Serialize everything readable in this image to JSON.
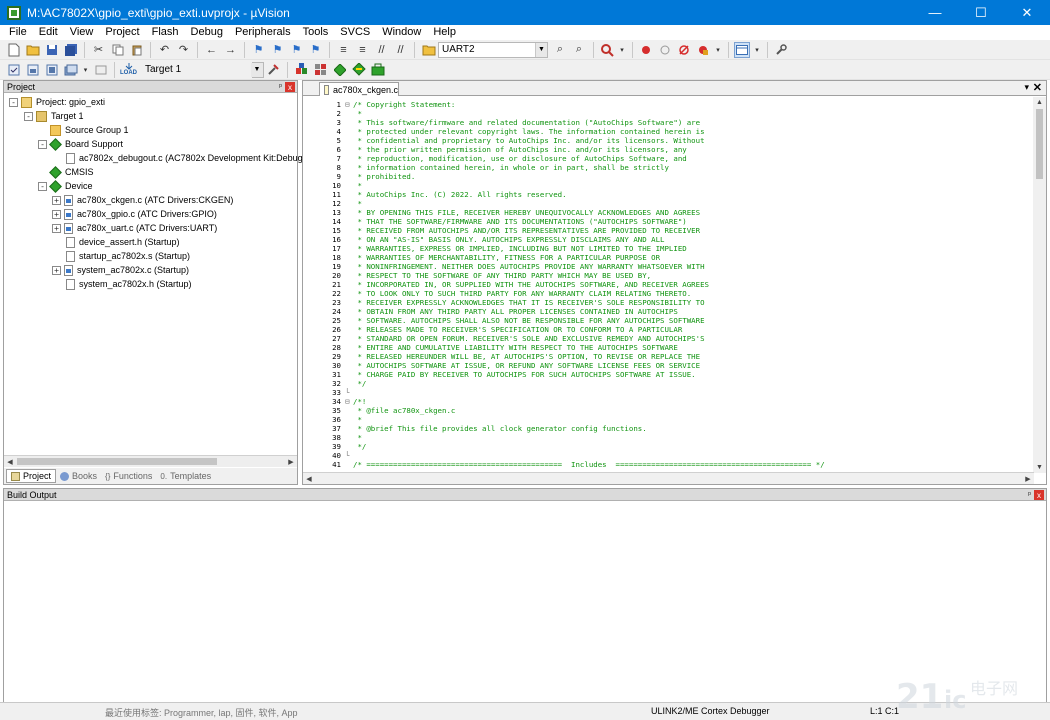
{
  "window": {
    "title": "M:\\AC7802X\\gpio_exti\\gpio_exti.uvprojx - µVision",
    "minimize_glyph": "—",
    "maximize_glyph": "☐",
    "close_glyph": "✕"
  },
  "menu": [
    "File",
    "Edit",
    "View",
    "Project",
    "Flash",
    "Debug",
    "Peripherals",
    "Tools",
    "SVCS",
    "Window",
    "Help"
  ],
  "toolbar": {
    "find_combo_value": "UART2",
    "target_combo_value": "Target 1",
    "load_label": "LOAD"
  },
  "project_panel": {
    "title": "Project",
    "pin_glyph": "ᵖ",
    "close_glyph": "x",
    "tree": [
      {
        "label": "Project: gpio_exti",
        "expander": "-",
        "icon": "project-icon"
      },
      {
        "label": "Target 1",
        "expander": "-",
        "icon": "target-icon"
      },
      {
        "label": "Source Group 1",
        "expander": "",
        "icon": "folder-icon"
      },
      {
        "label": "Board Support",
        "expander": "-",
        "icon": "green-diamond-icon"
      },
      {
        "label": "ac7802x_debugout.c (AC7802x Development Kit:Debug)",
        "expander": "",
        "icon": "file-icon"
      },
      {
        "label": "CMSIS",
        "expander": "",
        "icon": "green-diamond-icon"
      },
      {
        "label": "Device",
        "expander": "-",
        "icon": "green-diamond-icon"
      },
      {
        "label": "ac780x_ckgen.c (ATC Drivers:CKGEN)",
        "expander": "+",
        "icon": "c-file-icon"
      },
      {
        "label": "ac780x_gpio.c (ATC Drivers:GPIO)",
        "expander": "+",
        "icon": "c-file-icon"
      },
      {
        "label": "ac780x_uart.c (ATC Drivers:UART)",
        "expander": "+",
        "icon": "c-file-icon"
      },
      {
        "label": "device_assert.h (Startup)",
        "expander": "",
        "icon": "file-icon"
      },
      {
        "label": "startup_ac7802x.s (Startup)",
        "expander": "",
        "icon": "file-icon"
      },
      {
        "label": "system_ac7802x.c (Startup)",
        "expander": "+",
        "icon": "c-file-icon"
      },
      {
        "label": "system_ac7802x.h (Startup)",
        "expander": "",
        "icon": "file-icon"
      }
    ],
    "tabs": [
      "Project",
      "Books",
      "Functions",
      "Templates"
    ]
  },
  "editor": {
    "tab_label": "ac780x_ckgen.c",
    "dropdown_glyph": "▾",
    "close_glyph": "✕",
    "lines": [
      {
        "n": "1",
        "fold": "⊟",
        "text": "/* Copyright Statement:"
      },
      {
        "n": "2",
        "fold": "",
        "text": " *"
      },
      {
        "n": "3",
        "fold": "",
        "text": " * This software/firmware and related documentation (\"AutoChips Software\") are"
      },
      {
        "n": "4",
        "fold": "",
        "text": " * protected under relevant copyright laws. The information contained herein is"
      },
      {
        "n": "5",
        "fold": "",
        "text": " * confidential and proprietary to AutoChips Inc. and/or its licensors. Without"
      },
      {
        "n": "6",
        "fold": "",
        "text": " * the prior written permission of AutoChips inc. and/or its licensors, any"
      },
      {
        "n": "7",
        "fold": "",
        "text": " * reproduction, modification, use or disclosure of AutoChips Software, and"
      },
      {
        "n": "8",
        "fold": "",
        "text": " * information contained herein, in whole or in part, shall be strictly"
      },
      {
        "n": "9",
        "fold": "",
        "text": " * prohibited."
      },
      {
        "n": "10",
        "fold": "",
        "text": " *"
      },
      {
        "n": "11",
        "fold": "",
        "text": " * AutoChips Inc. (C) 2022. All rights reserved."
      },
      {
        "n": "12",
        "fold": "",
        "text": " *"
      },
      {
        "n": "13",
        "fold": "",
        "text": " * BY OPENING THIS FILE, RECEIVER HEREBY UNEQUIVOCALLY ACKNOWLEDGES AND AGREES"
      },
      {
        "n": "14",
        "fold": "",
        "text": " * THAT THE SOFTWARE/FIRMWARE AND ITS DOCUMENTATIONS (\"AUTOCHIPS SOFTWARE\")"
      },
      {
        "n": "15",
        "fold": "",
        "text": " * RECEIVED FROM AUTOCHIPS AND/OR ITS REPRESENTATIVES ARE PROVIDED TO RECEIVER"
      },
      {
        "n": "16",
        "fold": "",
        "text": " * ON AN \"AS-IS\" BASIS ONLY. AUTOCHIPS EXPRESSLY DISCLAIMS ANY AND ALL"
      },
      {
        "n": "17",
        "fold": "",
        "text": " * WARRANTIES, EXPRESS OR IMPLIED, INCLUDING BUT NOT LIMITED TO THE IMPLIED"
      },
      {
        "n": "18",
        "fold": "",
        "text": " * WARRANTIES OF MERCHANTABILITY, FITNESS FOR A PARTICULAR PURPOSE OR"
      },
      {
        "n": "19",
        "fold": "",
        "text": " * NONINFRINGEMENT. NEITHER DOES AUTOCHIPS PROVIDE ANY WARRANTY WHATSOEVER WITH"
      },
      {
        "n": "20",
        "fold": "",
        "text": " * RESPECT TO THE SOFTWARE OF ANY THIRD PARTY WHICH MAY BE USED BY,"
      },
      {
        "n": "21",
        "fold": "",
        "text": " * INCORPORATED IN, OR SUPPLIED WITH THE AUTOCHIPS SOFTWARE, AND RECEIVER AGREES"
      },
      {
        "n": "22",
        "fold": "",
        "text": " * TO LOOK ONLY TO SUCH THIRD PARTY FOR ANY WARRANTY CLAIM RELATING THERETO."
      },
      {
        "n": "23",
        "fold": "",
        "text": " * RECEIVER EXPRESSLY ACKNOWLEDGES THAT IT IS RECEIVER'S SOLE RESPONSIBILITY TO"
      },
      {
        "n": "24",
        "fold": "",
        "text": " * OBTAIN FROM ANY THIRD PARTY ALL PROPER LICENSES CONTAINED IN AUTOCHIPS"
      },
      {
        "n": "25",
        "fold": "",
        "text": " * SOFTWARE. AUTOCHIPS SHALL ALSO NOT BE RESPONSIBLE FOR ANY AUTOCHIPS SOFTWARE"
      },
      {
        "n": "26",
        "fold": "",
        "text": " * RELEASES MADE TO RECEIVER'S SPECIFICATION OR TO CONFORM TO A PARTICULAR"
      },
      {
        "n": "27",
        "fold": "",
        "text": " * STANDARD OR OPEN FORUM. RECEIVER'S SOLE AND EXCLUSIVE REMEDY AND AUTOCHIPS'S"
      },
      {
        "n": "28",
        "fold": "",
        "text": " * ENTIRE AND CUMULATIVE LIABILITY WITH RESPECT TO THE AUTOCHIPS SOFTWARE"
      },
      {
        "n": "29",
        "fold": "",
        "text": " * RELEASED HEREUNDER WILL BE, AT AUTOCHIPS'S OPTION, TO REVISE OR REPLACE THE"
      },
      {
        "n": "30",
        "fold": "",
        "text": " * AUTOCHIPS SOFTWARE AT ISSUE, OR REFUND ANY SOFTWARE LICENSE FEES OR SERVICE"
      },
      {
        "n": "31",
        "fold": "",
        "text": " * CHARGE PAID BY RECEIVER TO AUTOCHIPS FOR SUCH AUTOCHIPS SOFTWARE AT ISSUE."
      },
      {
        "n": "32",
        "fold": "",
        "text": " */"
      },
      {
        "n": "33",
        "fold": "└",
        "text": ""
      },
      {
        "n": "34",
        "fold": "⊟",
        "text": "/*!"
      },
      {
        "n": "35",
        "fold": "",
        "text": " * @file ac780x_ckgen.c"
      },
      {
        "n": "36",
        "fold": "",
        "text": " *"
      },
      {
        "n": "37",
        "fold": "",
        "text": " * @brief This file provides all clock generator config functions."
      },
      {
        "n": "38",
        "fold": "",
        "text": " *"
      },
      {
        "n": "39",
        "fold": "",
        "text": " */"
      },
      {
        "n": "40",
        "fold": "└",
        "text": ""
      },
      {
        "n": "41",
        "fold": "",
        "text": "/* ============================================  Includes  ============================================ */"
      }
    ]
  },
  "build_output": {
    "title": "Build Output",
    "pin_glyph": "ᵖ",
    "close_glyph": "x"
  },
  "status": {
    "debugger": "ULINK2/ME Cortex Debugger",
    "position": "L:1 C:1",
    "taskbar_fragment": "最近使用标签: Programmer, lap, 固件, 软件, App"
  },
  "colors": {
    "titlebar": "#0078d7",
    "comment_green": "#119411"
  }
}
